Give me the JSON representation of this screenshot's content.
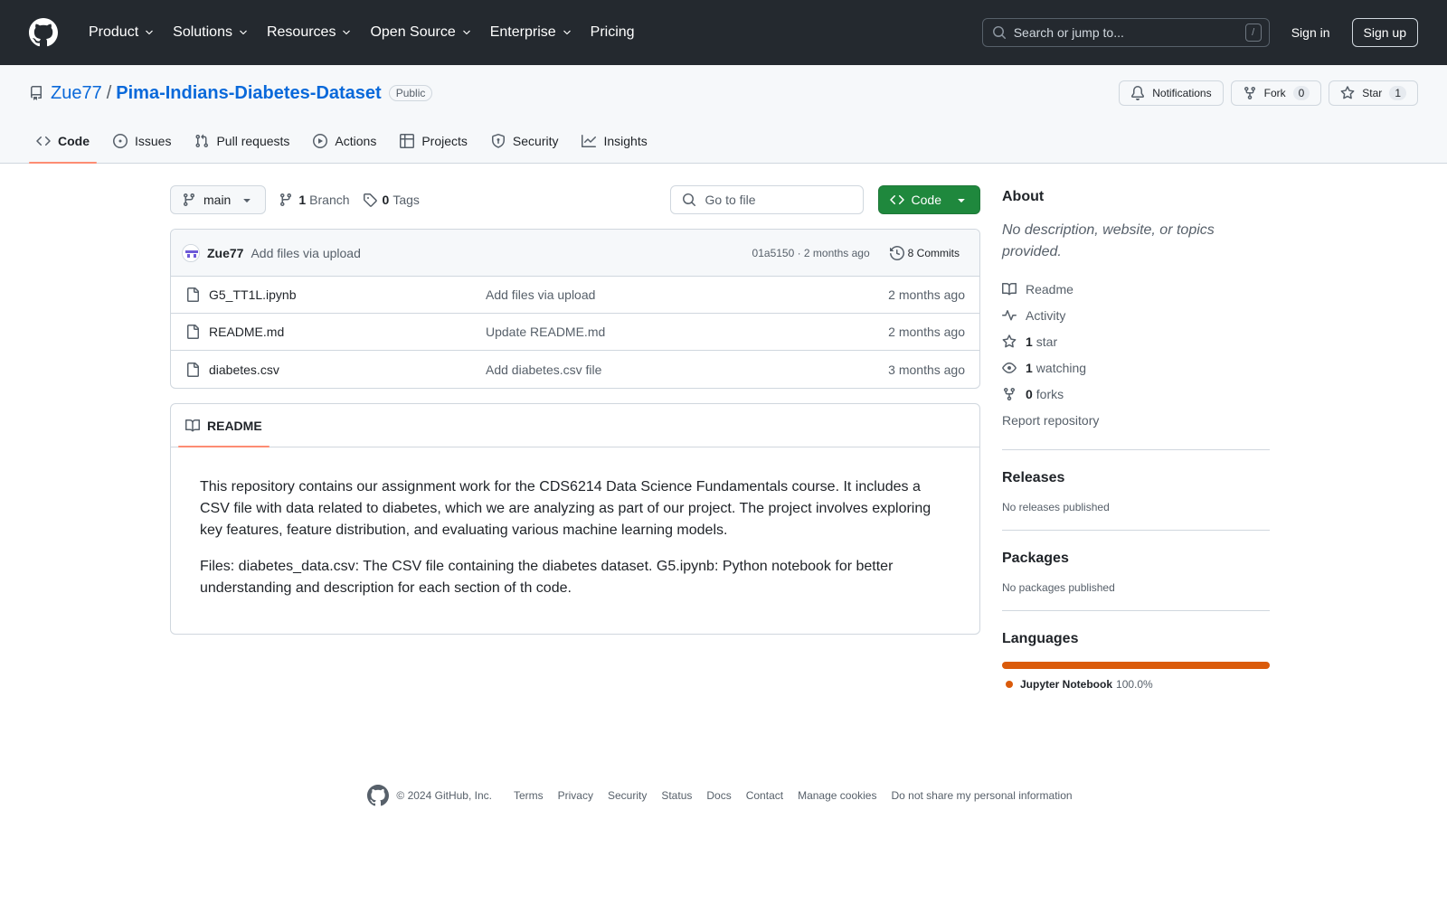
{
  "topnav": {
    "items": [
      "Product",
      "Solutions",
      "Resources",
      "Open Source",
      "Enterprise",
      "Pricing"
    ],
    "search_placeholder": "Search or jump to...",
    "search_key": "/",
    "sign_in": "Sign in",
    "sign_up": "Sign up"
  },
  "repo": {
    "owner": "Zue77",
    "separator": "/",
    "name": "Pima-Indians-Diabetes-Dataset",
    "visibility": "Public",
    "notifications_label": "Notifications",
    "fork_label": "Fork",
    "fork_count": "0",
    "star_label": "Star",
    "star_count": "1"
  },
  "tabs": [
    "Code",
    "Issues",
    "Pull requests",
    "Actions",
    "Projects",
    "Security",
    "Insights"
  ],
  "file_nav": {
    "branch": "main",
    "branch_count": "1",
    "branch_label": "Branch",
    "tag_count": "0",
    "tag_label": "Tags",
    "goto_placeholder": "Go to file",
    "code_button": "Code"
  },
  "commit": {
    "author": "Zue77",
    "message": "Add files via upload",
    "hash_time": "01a5150 · 2 months ago",
    "commits_label": "8 Commits"
  },
  "files": [
    {
      "name": "G5_TT1L.ipynb",
      "message": "Add files via upload",
      "date": "2 months ago"
    },
    {
      "name": "README.md",
      "message": "Update README.md",
      "date": "2 months ago"
    },
    {
      "name": "diabetes.csv",
      "message": "Add diabetes.csv file",
      "date": "3 months ago"
    }
  ],
  "readme": {
    "tab_label": "README",
    "paragraphs": [
      "This repository contains our assignment work for the CDS6214 Data Science Fundamentals course. It includes a CSV file with data related to diabetes, which we are analyzing as part of our project. The project involves exploring key features, feature distribution, and evaluating various machine learning models.",
      "Files: diabetes_data.csv: The CSV file containing the diabetes dataset. G5.ipynb: Python notebook for better understanding and description for each section of th code."
    ]
  },
  "about": {
    "heading": "About",
    "description": "No description, website, or topics provided.",
    "readme": "Readme",
    "activity": "Activity",
    "stars_count": "1",
    "stars_label": "star",
    "watching_count": "1",
    "watching_label": "watching",
    "forks_count": "0",
    "forks_label": "forks",
    "report": "Report repository"
  },
  "releases": {
    "heading": "Releases",
    "text": "No releases published"
  },
  "packages": {
    "heading": "Packages",
    "text": "No packages published"
  },
  "languages": {
    "heading": "Languages",
    "items": [
      {
        "name": "Jupyter Notebook",
        "percent": "100.0%",
        "color": "#da5b0b"
      }
    ]
  },
  "footer": {
    "copyright": "© 2024 GitHub, Inc.",
    "links": [
      "Terms",
      "Privacy",
      "Security",
      "Status",
      "Docs",
      "Contact",
      "Manage cookies",
      "Do not share my personal information"
    ]
  }
}
